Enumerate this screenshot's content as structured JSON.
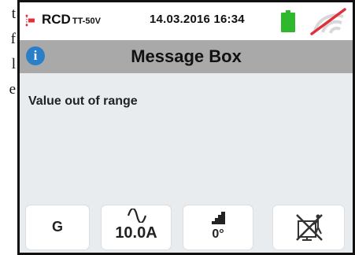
{
  "side_text": [
    "t",
    "f",
    "l",
    "e"
  ],
  "status": {
    "mode": "RCD",
    "mode_detail": "TT-50V",
    "datetime": "14.03.2016 16:34",
    "battery_color": "#2eb82e",
    "signal_icon": "no-signal-icon"
  },
  "dialog": {
    "icon": "info-icon",
    "icon_text": "i",
    "title": "Message Box",
    "message": "Value out of range"
  },
  "softkeys": {
    "key1_label": "G",
    "key2_waveform": "sine-wave-icon",
    "key2_value": "10.0A",
    "key3_icon": "ramp-icon",
    "key3_value": "0°",
    "key4_icon": "no-discharge-icon"
  },
  "colors": {
    "screen_bg": "#e9ecef",
    "titlebar_bg": "#a9a9a9",
    "info_blue": "#2a7fc9",
    "accent_red": "#e0303b"
  }
}
